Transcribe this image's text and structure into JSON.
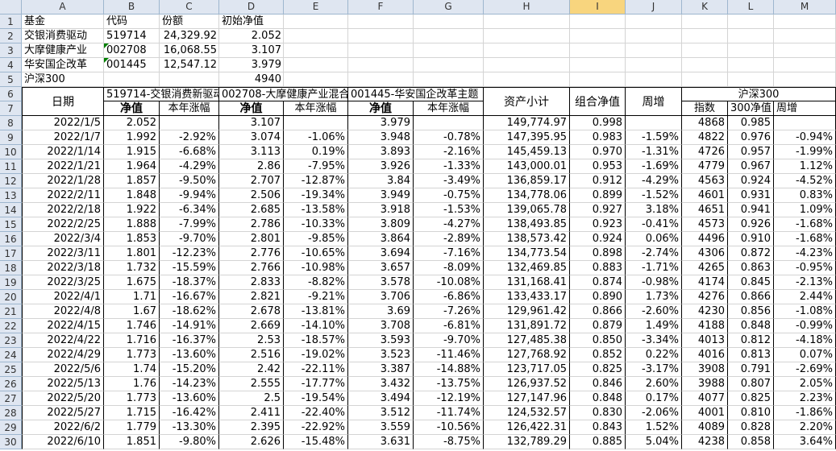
{
  "columns": [
    "A",
    "B",
    "C",
    "D",
    "E",
    "F",
    "G",
    "H",
    "I",
    "J",
    "K",
    "L",
    "M"
  ],
  "selected_column": "I",
  "rows": [
    "1",
    "2",
    "3",
    "4",
    "5",
    "6",
    "7",
    "8",
    "9",
    "10",
    "11",
    "12",
    "13",
    "14",
    "15",
    "16",
    "17",
    "18",
    "19",
    "20",
    "21",
    "22",
    "23",
    "24",
    "25",
    "26",
    "27",
    "28",
    "29",
    "30"
  ],
  "top": [
    [
      "基金",
      "代码",
      "份额",
      "初始净值"
    ],
    [
      "交银消费驱动",
      "519714",
      "24,329.92",
      "2.052"
    ],
    [
      "大摩健康产业",
      "002708",
      "16,068.55",
      "3.107"
    ],
    [
      "华安国企改革",
      "001445",
      "12,547.12",
      "3.979"
    ],
    [
      "沪深300",
      "",
      "",
      "4940"
    ]
  ],
  "header": {
    "date": "日期",
    "fund1": "519714-交银消费新驱动",
    "fund2": "002708-大摩健康产业混合",
    "fund3": "001445-华安国企改革主题",
    "nav": "净值",
    "ytd": "本年涨幅",
    "assets": "资产小计",
    "portfolio_nav": "组合净值",
    "weekly": "周增",
    "hs300": "沪深300",
    "index": "指数",
    "hs300_nav": "300净值",
    "hs300_weekly": "周增"
  },
  "data": [
    [
      "2022/1/5",
      "2.052",
      "",
      "3.107",
      "",
      "3.979",
      "",
      "149,774.97",
      "0.998",
      "",
      "4868",
      "0.985",
      ""
    ],
    [
      "2022/1/7",
      "1.992",
      "-2.92%",
      "3.074",
      "-1.06%",
      "3.948",
      "-0.78%",
      "147,395.95",
      "0.983",
      "-1.59%",
      "4822",
      "0.976",
      "-0.94%"
    ],
    [
      "2022/1/14",
      "1.915",
      "-6.68%",
      "3.113",
      "0.19%",
      "3.893",
      "-2.16%",
      "145,459.13",
      "0.970",
      "-1.31%",
      "4726",
      "0.957",
      "-1.99%"
    ],
    [
      "2022/1/21",
      "1.964",
      "-4.29%",
      "2.86",
      "-7.95%",
      "3.926",
      "-1.33%",
      "143,000.01",
      "0.953",
      "-1.69%",
      "4779",
      "0.967",
      "1.12%"
    ],
    [
      "2022/1/28",
      "1.857",
      "-9.50%",
      "2.707",
      "-12.87%",
      "3.84",
      "-3.49%",
      "136,859.17",
      "0.912",
      "-4.29%",
      "4563",
      "0.924",
      "-4.52%"
    ],
    [
      "2022/2/11",
      "1.848",
      "-9.94%",
      "2.506",
      "-19.34%",
      "3.949",
      "-0.75%",
      "134,778.06",
      "0.899",
      "-1.52%",
      "4601",
      "0.931",
      "0.83%"
    ],
    [
      "2022/2/18",
      "1.922",
      "-6.34%",
      "2.685",
      "-13.58%",
      "3.918",
      "-1.53%",
      "139,065.78",
      "0.927",
      "3.18%",
      "4651",
      "0.941",
      "1.09%"
    ],
    [
      "2022/2/25",
      "1.888",
      "-7.99%",
      "2.786",
      "-10.33%",
      "3.809",
      "-4.27%",
      "138,493.85",
      "0.923",
      "-0.41%",
      "4573",
      "0.926",
      "-1.68%"
    ],
    [
      "2022/3/4",
      "1.853",
      "-9.70%",
      "2.801",
      "-9.85%",
      "3.864",
      "-2.89%",
      "138,573.42",
      "0.924",
      "0.06%",
      "4496",
      "0.910",
      "-1.68%"
    ],
    [
      "2022/3/11",
      "1.801",
      "-12.23%",
      "2.776",
      "-10.65%",
      "3.694",
      "-7.16%",
      "134,773.54",
      "0.898",
      "-2.74%",
      "4306",
      "0.872",
      "-4.23%"
    ],
    [
      "2022/3/18",
      "1.732",
      "-15.59%",
      "2.766",
      "-10.98%",
      "3.657",
      "-8.09%",
      "132,469.85",
      "0.883",
      "-1.71%",
      "4265",
      "0.863",
      "-0.95%"
    ],
    [
      "2022/3/25",
      "1.675",
      "-18.37%",
      "2.833",
      "-8.82%",
      "3.578",
      "-10.08%",
      "131,168.41",
      "0.874",
      "-0.98%",
      "4174",
      "0.845",
      "-2.13%"
    ],
    [
      "2022/4/1",
      "1.71",
      "-16.67%",
      "2.821",
      "-9.21%",
      "3.706",
      "-6.86%",
      "133,433.17",
      "0.890",
      "1.73%",
      "4276",
      "0.866",
      "2.44%"
    ],
    [
      "2022/4/8",
      "1.67",
      "-18.62%",
      "2.678",
      "-13.81%",
      "3.69",
      "-7.26%",
      "129,961.42",
      "0.866",
      "-2.60%",
      "4230",
      "0.856",
      "-1.08%"
    ],
    [
      "2022/4/15",
      "1.746",
      "-14.91%",
      "2.669",
      "-14.10%",
      "3.708",
      "-6.81%",
      "131,891.72",
      "0.879",
      "1.49%",
      "4188",
      "0.848",
      "-0.99%"
    ],
    [
      "2022/4/22",
      "1.716",
      "-16.37%",
      "2.53",
      "-18.57%",
      "3.593",
      "-9.70%",
      "127,485.38",
      "0.850",
      "-3.34%",
      "4013",
      "0.812",
      "-4.18%"
    ],
    [
      "2022/4/29",
      "1.773",
      "-13.60%",
      "2.516",
      "-19.02%",
      "3.523",
      "-11.46%",
      "127,768.92",
      "0.852",
      "0.22%",
      "4016",
      "0.813",
      "0.07%"
    ],
    [
      "2022/5/6",
      "1.74",
      "-15.20%",
      "2.42",
      "-22.11%",
      "3.387",
      "-14.88%",
      "123,717.05",
      "0.825",
      "-3.17%",
      "3908",
      "0.791",
      "-2.69%"
    ],
    [
      "2022/5/13",
      "1.76",
      "-14.23%",
      "2.555",
      "-17.77%",
      "3.432",
      "-13.75%",
      "126,937.52",
      "0.846",
      "2.60%",
      "3988",
      "0.807",
      "2.05%"
    ],
    [
      "2022/5/20",
      "1.773",
      "-13.60%",
      "2.5",
      "-19.54%",
      "3.494",
      "-12.19%",
      "127,147.96",
      "0.848",
      "0.17%",
      "4077",
      "0.825",
      "2.23%"
    ],
    [
      "2022/5/27",
      "1.715",
      "-16.42%",
      "2.411",
      "-22.40%",
      "3.512",
      "-11.74%",
      "124,532.57",
      "0.830",
      "-2.06%",
      "4001",
      "0.810",
      "-1.86%"
    ],
    [
      "2022/6/2",
      "1.779",
      "-13.30%",
      "2.395",
      "-22.92%",
      "3.559",
      "-10.56%",
      "126,422.31",
      "0.843",
      "1.52%",
      "4089",
      "0.828",
      "2.20%"
    ],
    [
      "2022/6/10",
      "1.851",
      "-9.80%",
      "2.626",
      "-15.48%",
      "3.631",
      "-8.75%",
      "132,789.29",
      "0.885",
      "5.04%",
      "4238",
      "0.858",
      "3.64%"
    ]
  ]
}
